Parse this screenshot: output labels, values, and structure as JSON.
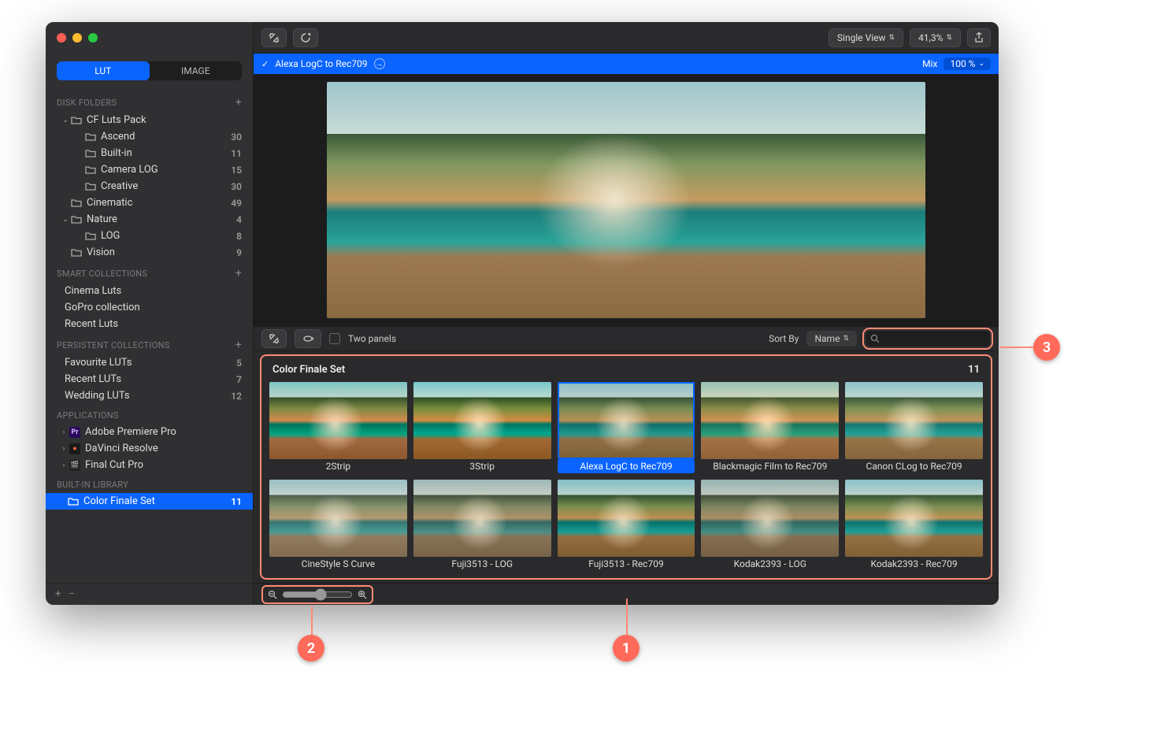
{
  "sidebar": {
    "tabs": {
      "lut": "LUT",
      "image": "IMAGE"
    },
    "sections": {
      "disk": "DISK FOLDERS",
      "smart": "SMART COLLECTIONS",
      "persistent": "PERSISTENT COLLECTIONS",
      "apps": "APPLICATIONS",
      "builtin": "BUILT-IN LIBRARY"
    },
    "disk": [
      {
        "label": "CF Luts Pack",
        "expanded": true,
        "indent": 0
      },
      {
        "label": "Ascend",
        "count": "30",
        "indent": 1
      },
      {
        "label": "Built-in",
        "count": "11",
        "indent": 1
      },
      {
        "label": "Camera LOG",
        "count": "15",
        "indent": 1
      },
      {
        "label": "Creative",
        "count": "30",
        "indent": 1
      },
      {
        "label": "Cinematic",
        "count": "49",
        "indent": 0
      },
      {
        "label": "Nature",
        "count": "4",
        "expanded": true,
        "indent": 0
      },
      {
        "label": "LOG",
        "count": "8",
        "indent": 1
      },
      {
        "label": "Vision",
        "count": "9",
        "indent": 0
      }
    ],
    "smart": [
      {
        "label": "Cinema Luts"
      },
      {
        "label": "GoPro collection"
      },
      {
        "label": "Recent Luts"
      }
    ],
    "persistent": [
      {
        "label": "Favourite LUTs",
        "count": "5"
      },
      {
        "label": "Recent LUTs",
        "count": "7"
      },
      {
        "label": "Wedding LUTs",
        "count": "12"
      }
    ],
    "apps": [
      {
        "label": "Adobe Premiere Pro",
        "iconBg": "#2a0a5a",
        "iconTxt": "Pr",
        "iconColor": "#d9b8ff"
      },
      {
        "label": "DaVinci Resolve",
        "iconBg": "#1a1a1a",
        "iconTxt": "●",
        "iconColor": "#ff6a3c"
      },
      {
        "label": "Final Cut Pro",
        "iconBg": "#222",
        "iconTxt": "🎬",
        "iconColor": "#fff"
      }
    ],
    "builtin": [
      {
        "label": "Color Finale Set",
        "count": "11",
        "selected": true
      }
    ]
  },
  "toolbar": {
    "viewMode": "Single View",
    "zoomPct": "41,3%"
  },
  "applied": {
    "name": "Alexa LogC to Rec709",
    "mixLabel": "Mix",
    "mixValue": "100 %"
  },
  "browser": {
    "twoPanels": "Two panels",
    "sortByLabel": "Sort By",
    "sortValue": "Name",
    "setTitle": "Color Finale Set",
    "setCount": "11",
    "thumbs": [
      {
        "label": "2Strip",
        "cls": "t-2strip"
      },
      {
        "label": "3Strip",
        "cls": "t-3strip"
      },
      {
        "label": "Alexa LogC to Rec709",
        "selected": true,
        "cls": "t-alexa"
      },
      {
        "label": "Blackmagic Film to Rec709",
        "cls": "t-bm"
      },
      {
        "label": "Canon CLog to Rec709",
        "cls": "t-canon"
      },
      {
        "label": "CineStyle S Curve",
        "cls": "t-cine"
      },
      {
        "label": "Fuji3513 - LOG",
        "cls": "t-fujiL"
      },
      {
        "label": "Fuji3513 - Rec709",
        "cls": "t-fujiR"
      },
      {
        "label": "Kodak2393 - LOG",
        "cls": "t-kodL"
      },
      {
        "label": "Kodak2393 - Rec709",
        "cls": "t-kodR"
      }
    ]
  },
  "callouts": {
    "one": "1",
    "two": "2",
    "three": "3"
  }
}
